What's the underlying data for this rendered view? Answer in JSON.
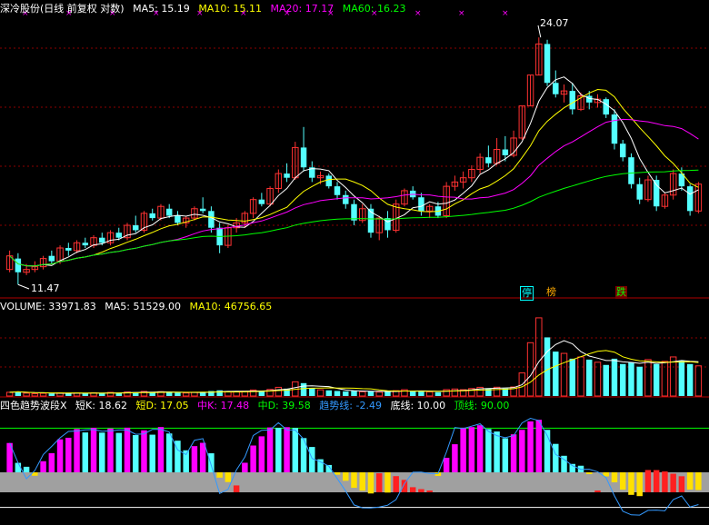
{
  "main_panel": {
    "stock_name": "深冷股份",
    "period_label": "(日线 前复权 对数)",
    "ma5": {
      "label": "MA5:",
      "value": "15.19",
      "color": "#ffffff"
    },
    "ma10": {
      "label": "MA10:",
      "value": "15.11",
      "color": "#ffff00"
    },
    "ma20": {
      "label": "MA20:",
      "value": "17.17",
      "color": "#ff00ff"
    },
    "ma60": {
      "label": "MA60:",
      "value": "16.23",
      "color": "#00ff00"
    },
    "high_label": "24.07",
    "low_label": "11.47",
    "event_tags": [
      {
        "text": "停",
        "color": "#00ffff"
      },
      {
        "text": "榜",
        "color": "#ffaa00"
      },
      {
        "text": "跌",
        "color": "#00ff00"
      }
    ]
  },
  "volume_panel": {
    "volume": {
      "label": "VOLUME:",
      "value": "33971.83",
      "color": "#ffffff"
    },
    "ma5": {
      "label": "MA5:",
      "value": "51529.00",
      "color": "#ffffff"
    },
    "ma10": {
      "label": "MA10:",
      "value": "46756.65",
      "color": "#ffff00"
    }
  },
  "indicator_panel": {
    "name": "四色趋势波段X",
    "items": [
      {
        "label": "短K:",
        "value": "18.62",
        "color": "#ffffff"
      },
      {
        "label": "短D:",
        "value": "17.05",
        "color": "#ffff00"
      },
      {
        "label": "中K:",
        "value": "17.48",
        "color": "#ff00ff"
      },
      {
        "label": "中D:",
        "value": "39.58",
        "color": "#00ff00"
      },
      {
        "label": "趋势线:",
        "value": "-2.49",
        "color": "#3399ff"
      },
      {
        "label": "底线:",
        "value": "10.00",
        "color": "#ffffff"
      },
      {
        "label": "顶线:",
        "value": "90.00",
        "color": "#00ff00"
      }
    ]
  },
  "colors": {
    "up": "#ff3232",
    "down": "#54ffff",
    "ma5": "#ffffff",
    "ma10": "#ffff00",
    "ma20": "#ff00ff",
    "ma60": "#00ff00",
    "grid": "#8b0000",
    "trend": "#3399ff",
    "band": "#a0a0a0"
  },
  "chart_data": [
    {
      "type": "candlestick",
      "title": "深冷股份(日线 前复权 对数)",
      "scale": "log",
      "ylim": [
        11.2,
        25.5
      ],
      "candles": [
        [
          12.0,
          12.7,
          11.9,
          12.5
        ],
        [
          12.4,
          12.6,
          11.47,
          11.9
        ],
        [
          11.9,
          12.2,
          11.8,
          12.0
        ],
        [
          12.0,
          12.3,
          11.9,
          12.1
        ],
        [
          12.1,
          12.5,
          12.0,
          12.4
        ],
        [
          12.5,
          12.7,
          12.2,
          12.3
        ],
        [
          12.3,
          12.9,
          12.2,
          12.8
        ],
        [
          12.8,
          13.0,
          12.5,
          12.7
        ],
        [
          12.7,
          13.1,
          12.6,
          13.0
        ],
        [
          13.0,
          13.2,
          12.8,
          12.9
        ],
        [
          12.9,
          13.3,
          12.8,
          13.2
        ],
        [
          13.2,
          13.4,
          12.9,
          13.0
        ],
        [
          13.0,
          13.5,
          12.9,
          13.4
        ],
        [
          13.4,
          13.6,
          13.1,
          13.2
        ],
        [
          13.2,
          13.8,
          13.1,
          13.7
        ],
        [
          13.7,
          14.1,
          13.4,
          13.5
        ],
        [
          13.5,
          14.3,
          13.4,
          14.2
        ],
        [
          14.2,
          14.4,
          13.9,
          14.0
        ],
        [
          14.0,
          14.6,
          13.9,
          14.5
        ],
        [
          14.4,
          14.6,
          14.0,
          14.1
        ],
        [
          14.1,
          14.3,
          13.7,
          13.8
        ],
        [
          13.8,
          14.1,
          13.6,
          14.0
        ],
        [
          14.0,
          14.5,
          13.9,
          14.4
        ],
        [
          14.4,
          14.9,
          14.2,
          14.3
        ],
        [
          14.3,
          14.5,
          13.4,
          13.6
        ],
        [
          13.6,
          13.8,
          12.6,
          12.9
        ],
        [
          12.9,
          13.7,
          12.8,
          13.6
        ],
        [
          13.6,
          14.0,
          13.4,
          13.8
        ],
        [
          13.8,
          14.3,
          13.6,
          14.2
        ],
        [
          14.2,
          14.9,
          14.0,
          14.8
        ],
        [
          14.8,
          15.1,
          14.5,
          14.6
        ],
        [
          14.6,
          15.4,
          14.5,
          15.3
        ],
        [
          15.3,
          16.2,
          15.1,
          16.0
        ],
        [
          16.0,
          16.5,
          15.6,
          15.8
        ],
        [
          15.8,
          17.6,
          15.7,
          17.3
        ],
        [
          17.3,
          18.4,
          16.1,
          16.3
        ],
        [
          16.3,
          16.6,
          15.6,
          15.8
        ],
        [
          15.8,
          16.1,
          15.5,
          15.9
        ],
        [
          15.9,
          16.0,
          15.3,
          15.4
        ],
        [
          15.4,
          15.6,
          14.8,
          15.0
        ],
        [
          15.0,
          15.2,
          14.4,
          14.6
        ],
        [
          14.6,
          14.8,
          13.7,
          13.9
        ],
        [
          13.9,
          14.6,
          13.8,
          14.4
        ],
        [
          14.4,
          14.6,
          13.2,
          13.4
        ],
        [
          13.4,
          14.1,
          13.1,
          14.0
        ],
        [
          14.0,
          14.3,
          13.2,
          13.5
        ],
        [
          13.5,
          14.8,
          13.4,
          14.6
        ],
        [
          14.6,
          15.3,
          14.5,
          15.2
        ],
        [
          15.2,
          15.4,
          14.8,
          14.9
        ],
        [
          14.9,
          15.1,
          14.1,
          14.3
        ],
        [
          14.3,
          14.6,
          14.0,
          14.5
        ],
        [
          14.5,
          14.7,
          14.0,
          14.1
        ],
        [
          14.1,
          15.6,
          14.0,
          15.4
        ],
        [
          15.4,
          15.9,
          15.2,
          15.6
        ],
        [
          15.6,
          16.1,
          15.3,
          15.8
        ],
        [
          15.8,
          16.4,
          15.6,
          16.2
        ],
        [
          16.2,
          17.0,
          16.0,
          16.8
        ],
        [
          16.8,
          17.4,
          16.3,
          16.5
        ],
        [
          16.5,
          17.8,
          16.4,
          17.2
        ],
        [
          17.2,
          17.9,
          16.6,
          16.9
        ],
        [
          16.9,
          18.2,
          16.8,
          17.8
        ],
        [
          17.8,
          19.6,
          17.7,
          19.6
        ],
        [
          19.6,
          21.5,
          19.6,
          21.5
        ],
        [
          21.5,
          24.07,
          21.5,
          23.6
        ],
        [
          23.6,
          23.9,
          20.8,
          21.0
        ],
        [
          21.0,
          21.8,
          20.1,
          20.3
        ],
        [
          20.3,
          20.9,
          19.8,
          20.5
        ],
        [
          20.5,
          21.0,
          19.1,
          19.4
        ],
        [
          19.4,
          20.4,
          19.3,
          20.2
        ],
        [
          20.2,
          20.5,
          19.4,
          19.8
        ],
        [
          19.8,
          20.3,
          19.5,
          20.0
        ],
        [
          20.0,
          20.1,
          18.9,
          19.1
        ],
        [
          19.1,
          19.4,
          17.2,
          17.5
        ],
        [
          17.5,
          17.7,
          16.6,
          16.8
        ],
        [
          16.8,
          17.0,
          15.3,
          15.5
        ],
        [
          15.5,
          15.8,
          14.6,
          14.8
        ],
        [
          14.8,
          15.9,
          14.7,
          15.7
        ],
        [
          15.7,
          15.9,
          14.3,
          14.5
        ],
        [
          14.5,
          15.1,
          14.4,
          15.0
        ],
        [
          15.0,
          16.2,
          14.8,
          16.0
        ],
        [
          16.0,
          16.3,
          15.2,
          15.4
        ],
        [
          15.4,
          15.5,
          14.1,
          14.3
        ],
        [
          14.3,
          15.6,
          14.2,
          15.5
        ]
      ],
      "ma_lines": [
        "MA5",
        "MA10",
        "MA20",
        "MA60"
      ],
      "last_values": {
        "MA5": 15.19,
        "MA10": 15.11,
        "MA20": 17.17,
        "MA60": 16.23
      },
      "annotations": [
        "24.07",
        "11.47"
      ]
    },
    {
      "type": "bar",
      "title": "VOLUME",
      "values": [
        4200,
        5200,
        3200,
        2600,
        3000,
        2800,
        3600,
        3100,
        3400,
        2900,
        3700,
        3200,
        4100,
        3500,
        4600,
        4300,
        5200,
        4400,
        4900,
        4000,
        3600,
        3400,
        4200,
        4700,
        5600,
        6400,
        5100,
        4600,
        5300,
        6800,
        6100,
        7400,
        9800,
        8300,
        16000,
        14500,
        9200,
        7000,
        6400,
        5700,
        5200,
        5900,
        4800,
        5600,
        4500,
        4900,
        6000,
        7100,
        5400,
        5000,
        4700,
        4300,
        7200,
        7900,
        7100,
        8400,
        9800,
        8700,
        9900,
        8500,
        10200,
        26000,
        60000,
        88000,
        66000,
        50000,
        48000,
        42000,
        44000,
        41000,
        38000,
        35000,
        42000,
        36000,
        38000,
        33000,
        41000,
        36000,
        39000,
        44000,
        40000,
        36000,
        33971.83
      ],
      "ylim": [
        0,
        92000
      ]
    },
    {
      "type": "bar",
      "title": "四色趋势波段X",
      "ylim": [
        -5,
        105
      ],
      "reference_lines": {
        "底线": 10.0,
        "顶线": 90.0
      },
      "last_values": {
        "短K": 18.62,
        "短D": 17.05,
        "中K": 17.48,
        "中D": 39.58,
        "趋势线": -2.49
      }
    }
  ]
}
